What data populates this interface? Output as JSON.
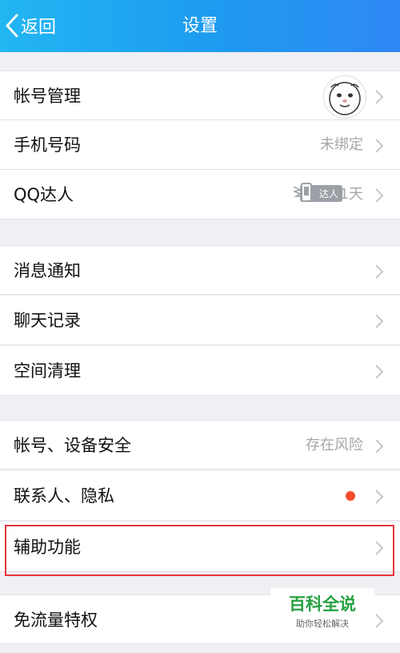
{
  "header": {
    "back_label": "返回",
    "title": "设置",
    "gradient_start": "#22b6f2",
    "gradient_end": "#2f88f4"
  },
  "group1": {
    "account": {
      "label": "帐号管理"
    },
    "phone": {
      "label": "手机号码",
      "value": "未绑定"
    },
    "qq_expert": {
      "label": "QQ达人",
      "badge": "达人",
      "days": "1天"
    }
  },
  "group2": {
    "notifications": {
      "label": "消息通知"
    },
    "chat_history": {
      "label": "聊天记录"
    },
    "storage": {
      "label": "空间清理"
    }
  },
  "group3": {
    "security": {
      "label": "帐号、设备安全",
      "value": "存在风险"
    },
    "privacy": {
      "label": "联系人、隐私",
      "dot_color": "#f64b2c"
    },
    "accessibility": {
      "label": "辅助功能"
    }
  },
  "group4": {
    "free_data": {
      "label": "免流量特权"
    }
  },
  "watermark": {
    "title": "百科全说",
    "subtitle": "助你轻松解决"
  },
  "colors": {
    "highlight": "#e5363c",
    "chevron": "#c7c7cc"
  }
}
